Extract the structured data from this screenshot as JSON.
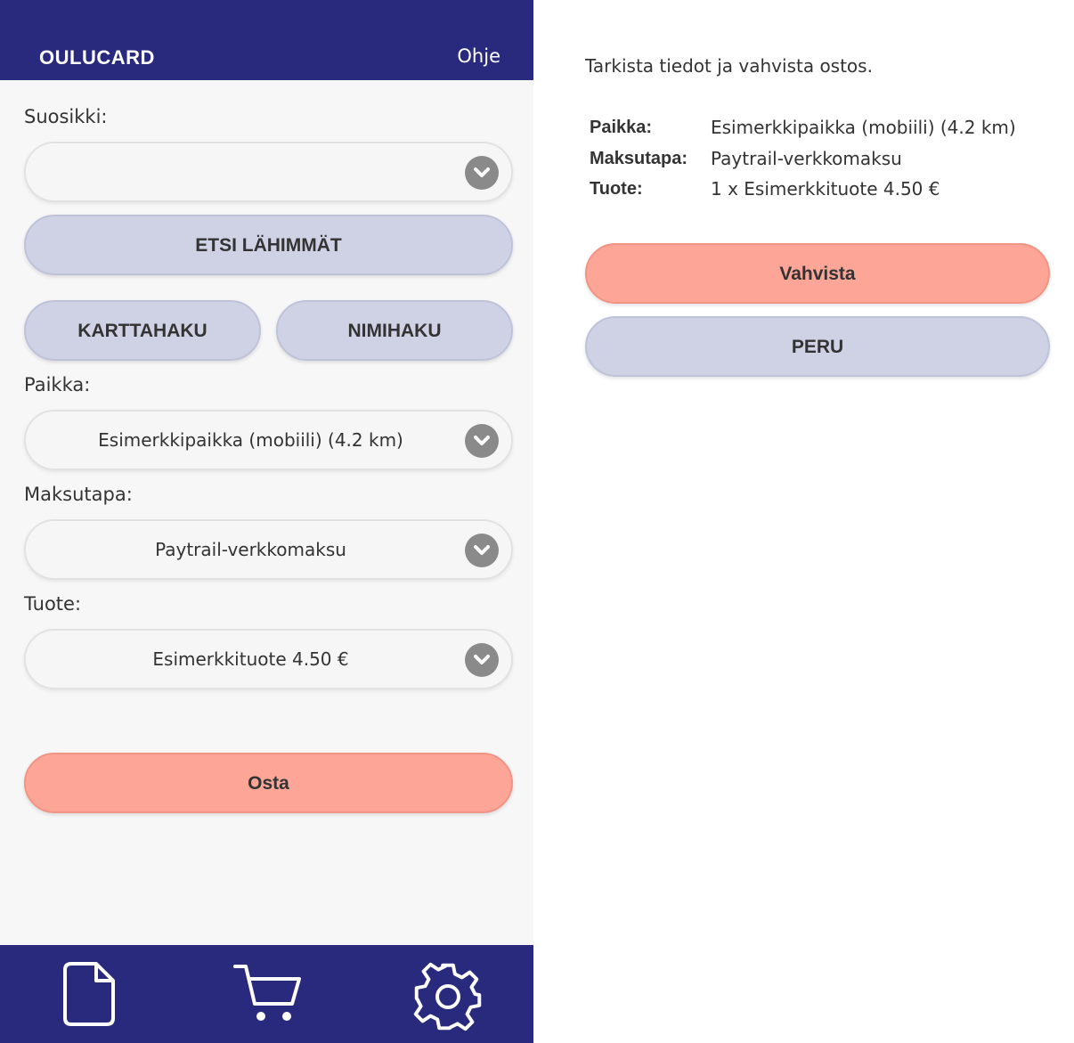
{
  "header": {
    "brand": "OULUCARD",
    "help_label": "Ohje"
  },
  "form": {
    "favorite_label": "Suosikki:",
    "favorite_value": "",
    "find_nearest_label": "ETSI LÄHIMMÄT",
    "map_search_label": "KARTTAHAKU",
    "name_search_label": "NIMIHAKU",
    "place_label": "Paikka:",
    "place_value": "Esimerkkipaikka (mobiili) (4.2 km)",
    "payment_label": "Maksutapa:",
    "payment_value": "Paytrail-verkkomaksu",
    "product_label": "Tuote:",
    "product_value": "Esimerkkituote 4.50 €",
    "buy_label": "Osta"
  },
  "bottom_nav": {
    "items": [
      {
        "icon": "document-icon"
      },
      {
        "icon": "cart-icon"
      },
      {
        "icon": "gear-icon"
      }
    ]
  },
  "confirm": {
    "intro": "Tarkista tiedot ja vahvista ostos.",
    "rows": [
      {
        "key": "Paikka:",
        "value": "Esimerkkipaikka (mobiili) (4.2 km)"
      },
      {
        "key": "Maksutapa:",
        "value": "Paytrail-verkkomaksu"
      },
      {
        "key": "Tuote:",
        "value": "1 x Esimerkkituote 4.50 €"
      }
    ],
    "confirm_label": "Vahvista",
    "cancel_label": "PERU"
  },
  "colors": {
    "header_bg": "#292a7e",
    "secondary_button": "#cfd2e4",
    "primary_button": "#fda597"
  }
}
